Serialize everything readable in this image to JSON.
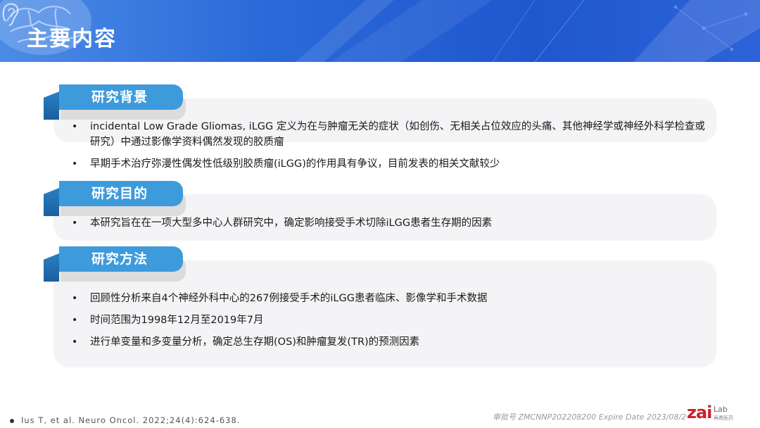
{
  "header": {
    "title": "主要内容"
  },
  "sections": [
    {
      "title": "研究背景",
      "bullets": [
        "incidental Low Grade Gliomas, iLGG 定义为在与肿瘤无关的症状（如创伤、无相关占位效应的头痛、其他神经学或神经外科学检查或研究）中通过影像学资料偶然发现的胶质瘤",
        "早期手术治疗弥漫性偶发性低级别胶质瘤(iLGG)的作用具有争议，目前发表的相关文献较少"
      ]
    },
    {
      "title": "研究目的",
      "bullets": [
        "本研究旨在在一项大型多中心人群研究中，确定影响接受手术切除iLGG患者生存期的因素"
      ]
    },
    {
      "title": "研究方法",
      "bullets": [
        "回顾性分析来自4个神经外科中心的267例接受手术的iLGG患者临床、影像学和手术数据",
        "时间范围为1998年12月至2019年7月",
        "进行单变量和多变量分析，确定总生存期(OS)和肿瘤复发(TR)的预测因素"
      ]
    }
  ],
  "bullet_glyph": "•",
  "footer": {
    "reference": "Ius T, et al. Neuro Oncol. 2022;24(4):624-638.",
    "approval": "审批号 ZMCNNP202208200 Expire Date 2023/08/2",
    "logo_text": "zai",
    "logo_sub": "Lab",
    "logo_cn": "再鼎医药"
  },
  "colors": {
    "header_blue": "#2a6ad8",
    "tab_blue": "#3d9bdc",
    "tab_dark": "#1d5fa3",
    "panel_bg": "#f4f4f6",
    "logo_red": "#d0202a"
  },
  "icons": [
    "brain-icon",
    "ear-icon"
  ]
}
